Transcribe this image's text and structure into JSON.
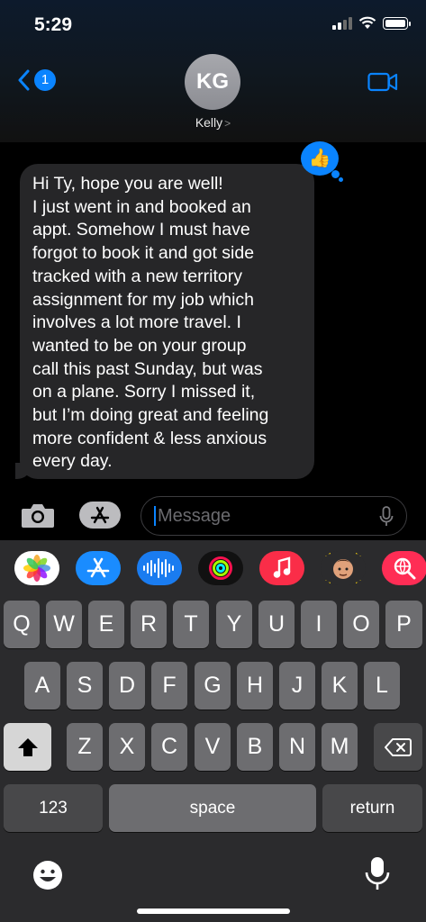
{
  "status_bar": {
    "time": "5:29"
  },
  "header": {
    "back_badge_count": "1",
    "avatar_initials": "KG",
    "contact_name": "Kelly",
    "contact_chevron": ">"
  },
  "message": {
    "text": "Hi Ty, hope you are well!\nI just went in and booked an\nappt. Somehow I must have\nforgot to book it and got side\ntracked with a new territory\nassignment for my job which\ninvolves a lot more travel. I\nwanted to be on your group\ncall this past Sunday, but was\non a plane. Sorry I missed it,\nbut I’m doing great and feeling\nmore confident & less anxious\nevery day.",
    "tapback_icon": "thumbs-up-icon",
    "tapback_glyph": "👍"
  },
  "input": {
    "placeholder": "Message"
  },
  "apps": [
    {
      "name": "photos-app",
      "color": "#ffffff"
    },
    {
      "name": "app-store-app",
      "color": "#1a8cff"
    },
    {
      "name": "audio-message-app",
      "color": "#1a7cf0"
    },
    {
      "name": "activity-app",
      "color": "#111111"
    },
    {
      "name": "music-app",
      "color": "#fa2d48"
    },
    {
      "name": "memoji-app",
      "color": "#ffd60a"
    },
    {
      "name": "search-images-app",
      "color": "#ff2d55"
    }
  ],
  "keyboard": {
    "row1": [
      "Q",
      "W",
      "E",
      "R",
      "T",
      "Y",
      "U",
      "I",
      "O",
      "P"
    ],
    "row2": [
      "A",
      "S",
      "D",
      "F",
      "G",
      "H",
      "J",
      "K",
      "L"
    ],
    "row3": [
      "Z",
      "X",
      "C",
      "V",
      "B",
      "N",
      "M"
    ],
    "numbers_label": "123",
    "space_label": "space",
    "return_label": "return"
  }
}
